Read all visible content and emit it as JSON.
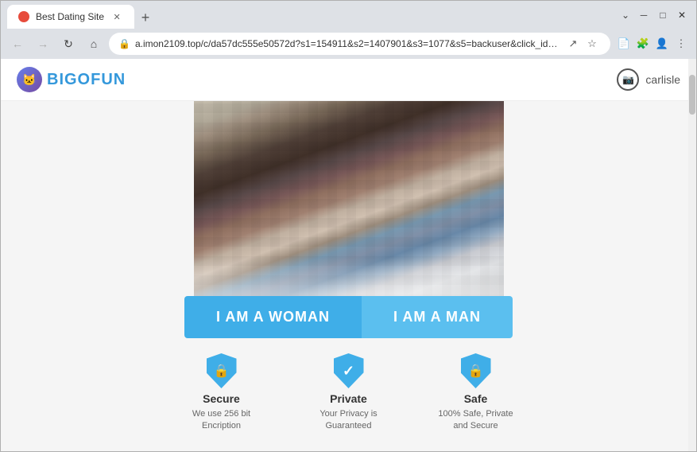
{
  "browser": {
    "tab_title": "Best Dating Site",
    "url": "a.imon2109.top/c/da57dc555e50572d?s1=154911&s2=1407901&s3=1077&s5=backuser&click_id=30...",
    "nav": {
      "back": "←",
      "forward": "→",
      "refresh": "↻",
      "home": "⌂"
    },
    "window_controls": {
      "minimize": "─",
      "maximize": "□",
      "close": "✕"
    },
    "new_tab": "+"
  },
  "site": {
    "logo_icon": "🐱",
    "logo_prefix": "BIGO",
    "logo_suffix": "FUN",
    "user_label": "carlisle"
  },
  "main": {
    "button_woman": "I AM A WOMAN",
    "button_man": "I AM A MAN"
  },
  "trust": [
    {
      "icon": "🔒",
      "title": "Secure",
      "desc": "We use 256 bit Encription"
    },
    {
      "icon": "✔",
      "title": "Private",
      "desc": "Your Privacy is Guaranteed"
    },
    {
      "icon": "🔒",
      "title": "Safe",
      "desc": "100% Safe, Private and Secure"
    }
  ]
}
